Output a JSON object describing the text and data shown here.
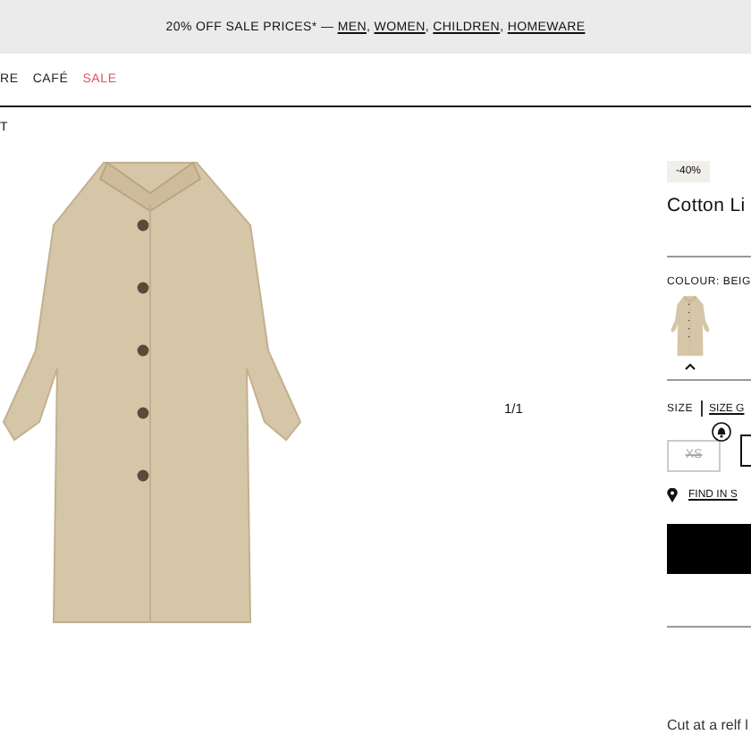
{
  "banner": {
    "text": "20% OFF SALE PRICES* —",
    "separator": ", ",
    "links": [
      "MEN",
      "WOMEN",
      "CHILDREN",
      "HOMEWARE"
    ]
  },
  "nav": [
    {
      "label": "RE",
      "kind": "normal"
    },
    {
      "label": "CAFÉ",
      "kind": "normal"
    },
    {
      "label": "SALE",
      "kind": "sale"
    }
  ],
  "breadcrumb": "T",
  "gallery": {
    "counter": "1/1"
  },
  "product": {
    "badge": "-40%",
    "title": "Cotton Li",
    "colour_label": "COLOUR: BEIG",
    "swatches": [
      {
        "selected": true
      }
    ],
    "size_label": "SIZE",
    "size_guide": "SIZE G",
    "sizes": [
      {
        "label": "XS",
        "available": false,
        "notify": true
      },
      {
        "available": true
      }
    ],
    "find_in_store": "FIND IN S",
    "description": "Cut at a relf l"
  }
}
